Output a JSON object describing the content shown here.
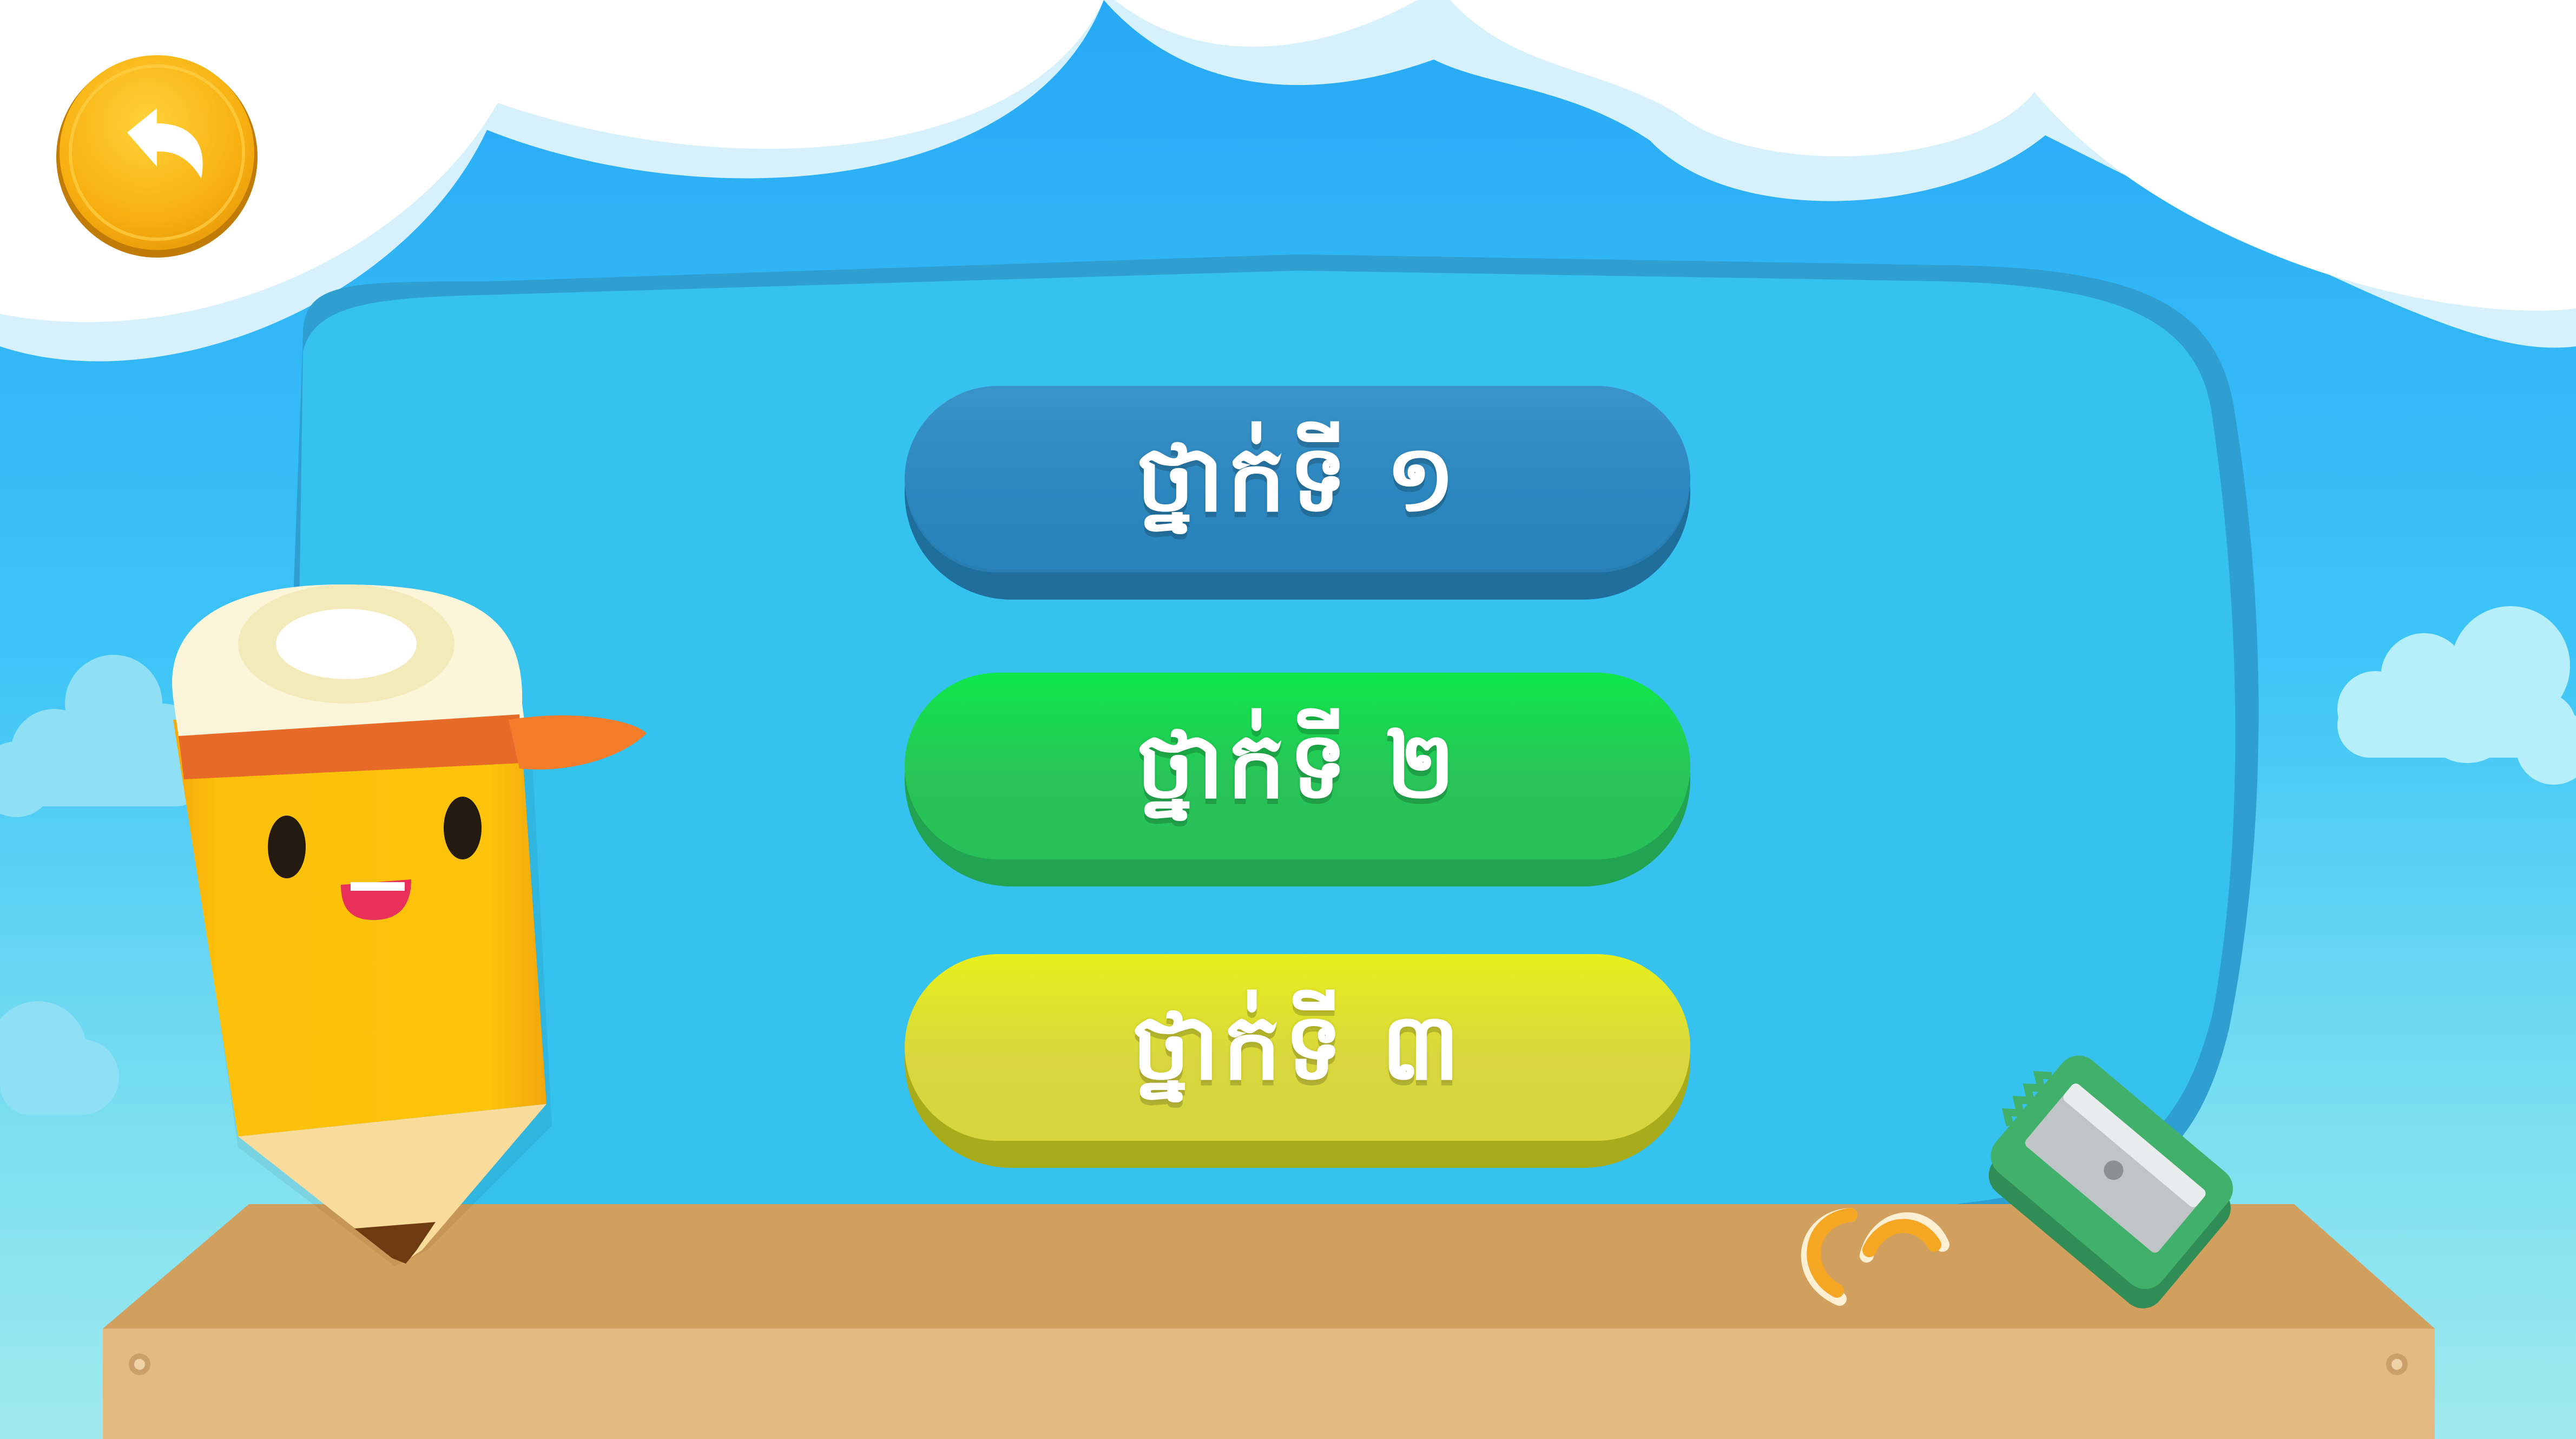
{
  "menu": {
    "buttons": [
      {
        "label": "ថ្នាក់ទី ១",
        "color": "#2a86bd"
      },
      {
        "label": "ថ្នាក់ទី ២",
        "color": "#28c458"
      },
      {
        "label": "ថ្នាក់ទី ៣",
        "color": "#d9d73d"
      }
    ]
  },
  "icons": {
    "back": "back-arrow-icon",
    "mascot": "pencil-mascot",
    "sharpener": "sharpener-icon",
    "shavings": "pencil-shavings"
  },
  "colors": {
    "sky": "#33bff5",
    "board": "#35c2ef",
    "table": "#e2b87e",
    "back_button": "#f7b310"
  }
}
